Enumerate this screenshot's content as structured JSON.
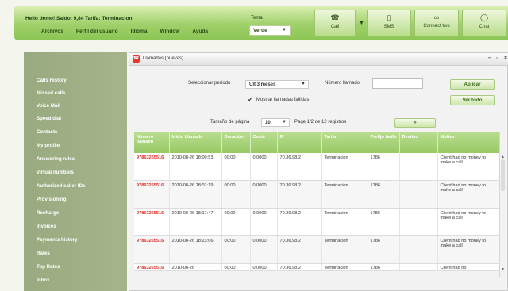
{
  "header": {
    "hello_text": "Hello demo! Saldo: 9,84 Tarifa: Terminacion",
    "menu": [
      "Archivos",
      "Perfil del usuario",
      "Idioma",
      "Window",
      "Ayuda"
    ],
    "tema_label": "Tema",
    "tema_value": "Verde",
    "buttons": [
      {
        "label": "Call",
        "icon": "phone-icon"
      },
      {
        "label": "SMS",
        "icon": "sms-icon"
      },
      {
        "label": "Connect two",
        "icon": "connect-icon"
      },
      {
        "label": "Chat",
        "icon": "chat-icon"
      }
    ]
  },
  "sidebar": {
    "items": [
      "Calls History",
      "Missed calls",
      "Voice Mail",
      "Speed dial",
      "Contacts",
      "My profile",
      "Answering rules",
      "Virtual numbers",
      "Authorized caller IDs",
      "Provisioning",
      "Recharge",
      "Invoices",
      "Payments history",
      "Rates",
      "Top Rates",
      "Inbox"
    ]
  },
  "window": {
    "title": "Llamadas (nuevas)",
    "period_label": "Seleccionar período",
    "period_value": "Ult 3 meses",
    "number_label": "Número llamado",
    "number_value": "",
    "apply_label": "Aplicar",
    "viewall_label": "Ver todo",
    "failed_label": "Mostrar llamadas fallidas",
    "failed_checked": true,
    "pagesize_label": "Tamaño de página",
    "pagesize_value": "10",
    "page_info": "Page 1/2 de 12 registros",
    "next_label": "»"
  },
  "table": {
    "headers": [
      "Número llamado",
      "Inicio Llamada",
      "Duración",
      "Coste",
      "IP",
      "Tarifa",
      "Prefijo tarifa",
      "Destino",
      "Motivo"
    ],
    "rows": [
      {
        "numero": "97863265516",
        "inicio": "2010-08-26 18:00:53",
        "duracion": "00:00",
        "coste": "0.0000",
        "ip": "70.36.98.2",
        "tarifa": "Terminacion",
        "prefijo": "1786",
        "destino": "",
        "motivo": "Client had no money to make a call"
      },
      {
        "numero": "97863265516",
        "inicio": "2010-08-26 18:01:19",
        "duracion": "00:00",
        "coste": "0.0000",
        "ip": "70.36.98.2",
        "tarifa": "Terminacion",
        "prefijo": "1786",
        "destino": "",
        "motivo": "Client had no money to make a call"
      },
      {
        "numero": "97863265516",
        "inicio": "2010-08-26 18:17:47",
        "duracion": "00:00",
        "coste": "0.0000",
        "ip": "70.36.98.2",
        "tarifa": "Terminacion",
        "prefijo": "1786",
        "destino": "",
        "motivo": "Client had no money to make a call"
      },
      {
        "numero": "97863265516",
        "inicio": "2010-08-26 18:23:06",
        "duracion": "00:00",
        "coste": "0.0000",
        "ip": "70.36.98.2",
        "tarifa": "Terminacion",
        "prefijo": "1786",
        "destino": "",
        "motivo": "Client had no money to make a call"
      },
      {
        "numero": "97863265516",
        "inicio": "2010-08-26",
        "duracion": "00:00",
        "coste": "0.0000",
        "ip": "70.36.98.2",
        "tarifa": "Terminacion",
        "prefijo": "1786",
        "destino": "",
        "motivo": "Client had no"
      }
    ]
  }
}
